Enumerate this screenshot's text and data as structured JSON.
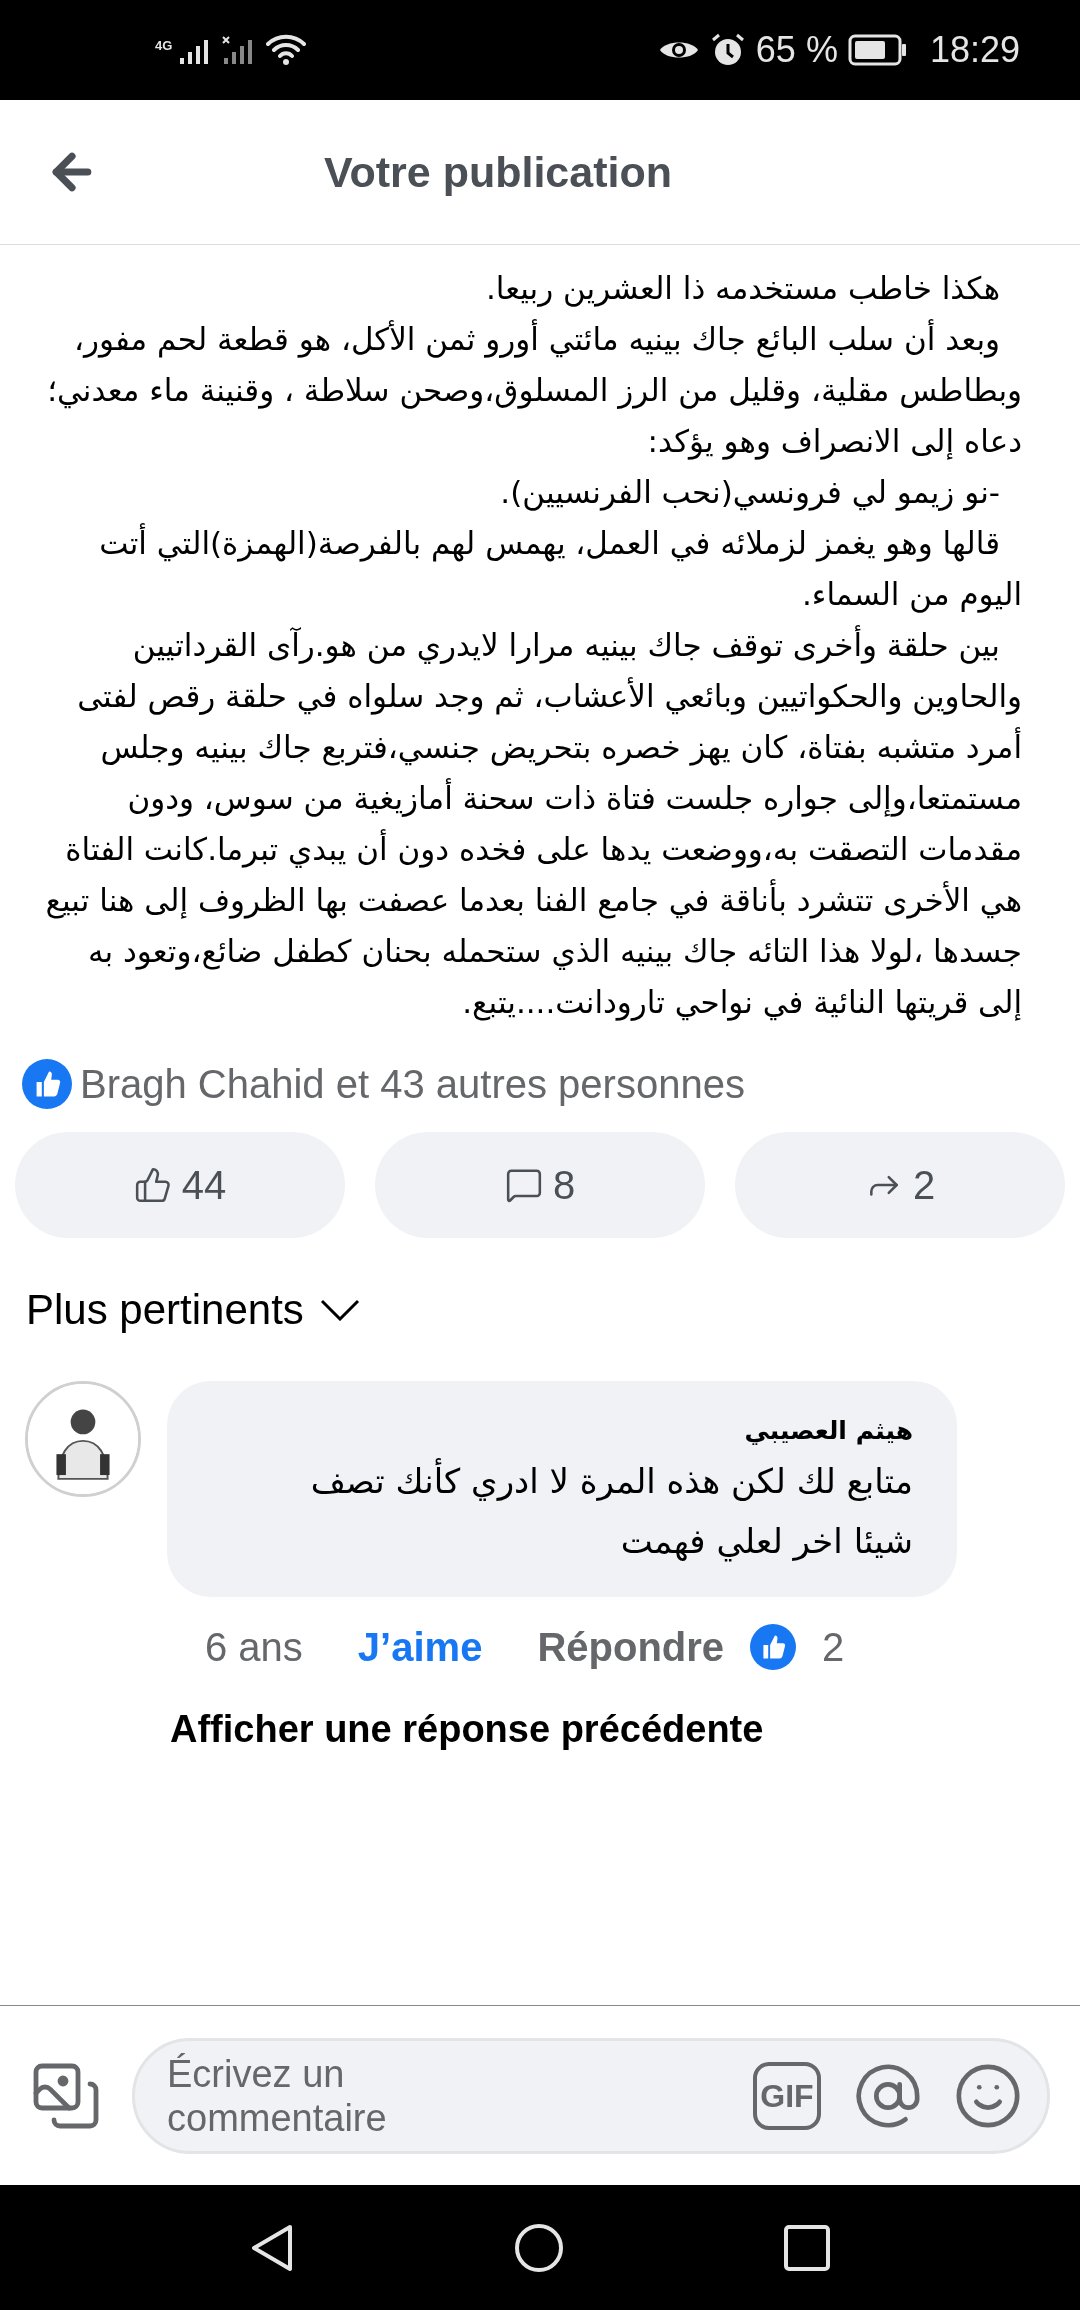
{
  "status_bar": {
    "network": "4G",
    "battery": "65 %",
    "time": "18:29"
  },
  "header": {
    "title": "Votre publication"
  },
  "post": {
    "paragraphs": [
      "هكذا خاطب مستخدمه ذا العشرين ربيعا.",
      "وبعد أن سلب البائع جاك بينيه مائتي أورو ثمن الأكل، هو قطعة لحم مفور، وبطاطس مقلية، وقليل من الرز المسلوق،وصحن سلاطة ، وقنينة ماء معدني؛ دعاه إلى الانصراف وهو يؤكد:",
      "-نو  زيمو  لي  فرونسي(نحب الفرنسيين).",
      "قالها وهو يغمز لزملائه في العمل، يهمس لهم بالفرصة(الهمزة)التي أتت اليوم من السماء.",
      "بين حلقة وأخرى توقف جاك بينيه مرارا لايدري من هو.رآى القرداتيين والحاوين والحكواتيين وبائعي الأعشاب، ثم وجد سلواه في حلقة رقص لفتى أمرد متشبه بفتاة، كان يهز خصره بتحريض جنسي،فتربع جاك بينيه وجلس مستمتعا،وإلى جواره جلست فتاة ذات سحنة أمازيغية من سوس، ودون مقدمات التصقت به،ووضعت يدها على فخده دون أن يبدي تبرما.كانت الفتاة هي الأخرى تتشرد بأناقة في جامع الفنا بعدما عصفت بها الظروف إلى هنا تبيع جسدها ،لولا هذا التائه جاك بينيه الذي ستحمله بحنان كطفل ضائع،وتعود به إلى قريتها النائية في نواحي تارودانت....يتبع."
    ],
    "reactions": "Bragh Chahid et 43 autres personnes",
    "actions": {
      "like": "44",
      "comment": "8",
      "share": "2"
    }
  },
  "sort": {
    "label": "Plus pertinents"
  },
  "comments": [
    {
      "author": "هيثم العصيبي",
      "text": "متابع لك لكن هذه المرة لا ادري كأنك تصف شيئا اخر لعلي فهمت",
      "age": "6 ans",
      "like_label": "J’aime",
      "liked": true,
      "reply_label": "Répondre",
      "reaction_count": "2"
    }
  ],
  "more_replies": "Afficher une réponse précédente",
  "composer": {
    "placeholder": "Écrivez un commentaire",
    "gif": "GIF"
  }
}
